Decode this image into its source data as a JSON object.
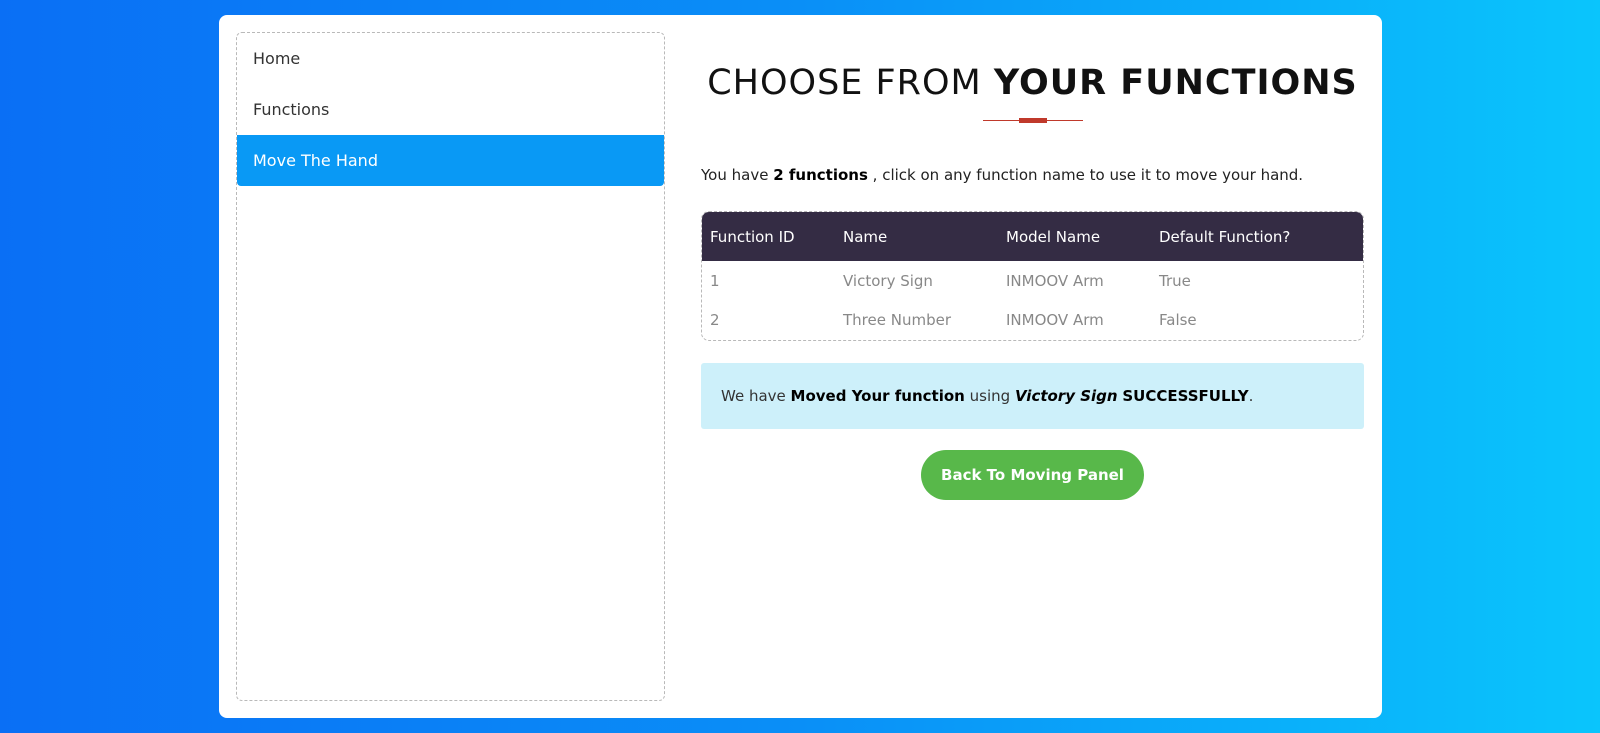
{
  "sidebar": {
    "items": [
      {
        "label": "Home"
      },
      {
        "label": "Functions"
      },
      {
        "label": "Move The Hand",
        "active": true
      }
    ]
  },
  "heading": {
    "light": "CHOOSE FROM",
    "bold": "YOUR FUNCTIONS"
  },
  "intro": {
    "prefix": "You have",
    "count": "2 functions",
    "suffix": ", click on any function name to use it to move your hand."
  },
  "table": {
    "headers": [
      "Function ID",
      "Name",
      "Model Name",
      "Default Function?"
    ],
    "rows": [
      [
        "1",
        "Victory Sign",
        "INMOOV Arm",
        "True"
      ],
      [
        "2",
        "Three Number",
        "INMOOV Arm",
        "False"
      ]
    ]
  },
  "alert": {
    "p1": "We have",
    "bold": "Moved Your function",
    "p2": "using",
    "function_name": "Victory Sign",
    "status": "SUCCESSFULLY",
    "p3": "."
  },
  "button": {
    "label": "Back To Moving Panel"
  },
  "colors": {
    "accent": "#0999f5",
    "header": "#342c44",
    "success": "#58b84a",
    "alert_bg": "#cdf0fa"
  }
}
